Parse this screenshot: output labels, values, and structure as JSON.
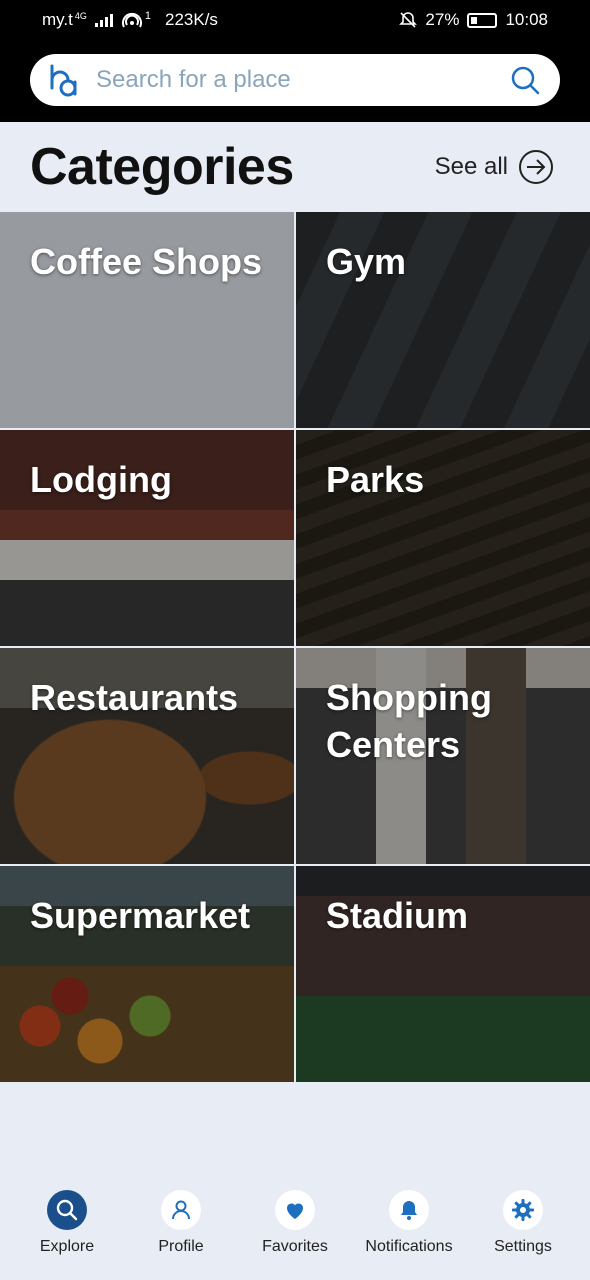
{
  "status_bar": {
    "carrier": "my.t",
    "network": "4G",
    "hotspot_count": "1",
    "speed": "223K/s",
    "battery": "27%",
    "time": "10:08"
  },
  "search": {
    "placeholder": "Search for a place"
  },
  "categories_header": {
    "title": "Categories",
    "see_all": "See all"
  },
  "categories": [
    {
      "label": "Coffee Shops"
    },
    {
      "label": "Gym"
    },
    {
      "label": "Lodging"
    },
    {
      "label": "Parks"
    },
    {
      "label": "Restaurants"
    },
    {
      "label": "Shopping Centers"
    },
    {
      "label": "Supermarket"
    },
    {
      "label": "Stadium"
    }
  ],
  "tabbar": {
    "items": [
      {
        "label": "Explore",
        "icon": "search-icon",
        "active": true
      },
      {
        "label": "Profile",
        "icon": "user-icon",
        "active": false
      },
      {
        "label": "Favorites",
        "icon": "heart-icon",
        "active": false
      },
      {
        "label": "Notifications",
        "icon": "bell-icon",
        "active": false
      },
      {
        "label": "Settings",
        "icon": "gear-icon",
        "active": false
      }
    ]
  },
  "colors": {
    "accent": "#1a4f8c",
    "icon_blue": "#1e6fbf",
    "background": "#e8edf5"
  }
}
